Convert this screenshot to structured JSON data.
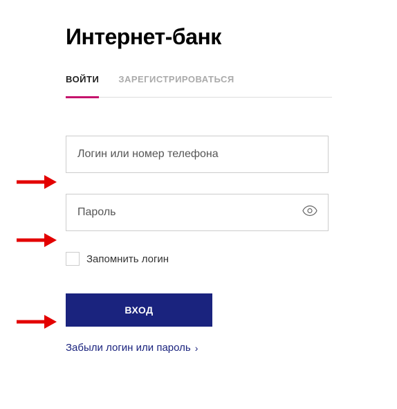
{
  "title": "Интернет-банк",
  "tabs": {
    "login": "ВОЙТИ",
    "register": "ЗАРЕГИСТРИРОВАТЬСЯ"
  },
  "form": {
    "login_placeholder": "Логин или номер телефона",
    "password_placeholder": "Пароль",
    "remember_label": "Запомнить логин",
    "submit_label": "ВХОД",
    "forgot_label": "Забыли логин или пароль"
  }
}
